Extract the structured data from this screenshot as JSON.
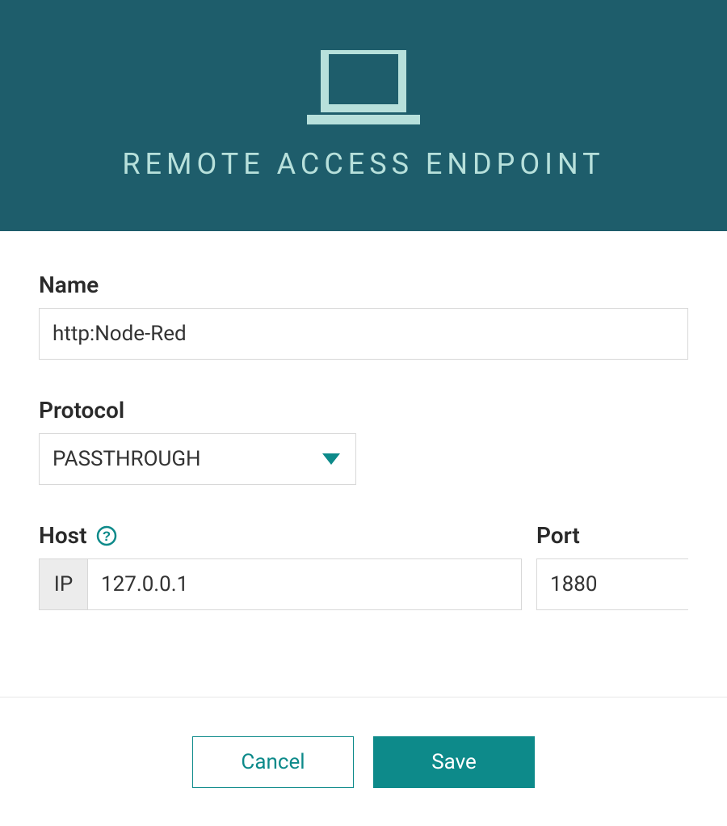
{
  "header": {
    "title": "REMOTE ACCESS ENDPOINT",
    "icon_name": "laptop-icon"
  },
  "form": {
    "name": {
      "label": "Name",
      "value": "http:Node-Red"
    },
    "protocol": {
      "label": "Protocol",
      "value": "PASSTHROUGH"
    },
    "host": {
      "label": "Host",
      "prefix": "IP",
      "value": "127.0.0.1"
    },
    "port": {
      "label": "Port",
      "value": "1880"
    }
  },
  "footer": {
    "cancel_label": "Cancel",
    "save_label": "Save"
  },
  "colors": {
    "header_bg": "#1e5d6b",
    "accent": "#0d8a8a",
    "icon_tint": "#b7e0db"
  }
}
